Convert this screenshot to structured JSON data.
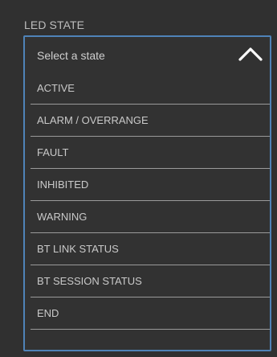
{
  "section_label": "LED STATE",
  "dropdown": {
    "placeholder": "Select a state",
    "expanded": true,
    "toggle_icon": "chevron-up-icon",
    "options": [
      {
        "label": "ACTIVE"
      },
      {
        "label": "ALARM / OVERRANGE"
      },
      {
        "label": "FAULT"
      },
      {
        "label": "INHIBITED"
      },
      {
        "label": "WARNING"
      },
      {
        "label": "BT LINK STATUS"
      },
      {
        "label": "BT SESSION STATUS"
      },
      {
        "label": "END"
      }
    ]
  },
  "colors": {
    "background": "#303030",
    "focus_border": "#4f83b8",
    "text": "#c9c9c9",
    "divider": "#9a9a9a",
    "icon": "#ffffff"
  }
}
